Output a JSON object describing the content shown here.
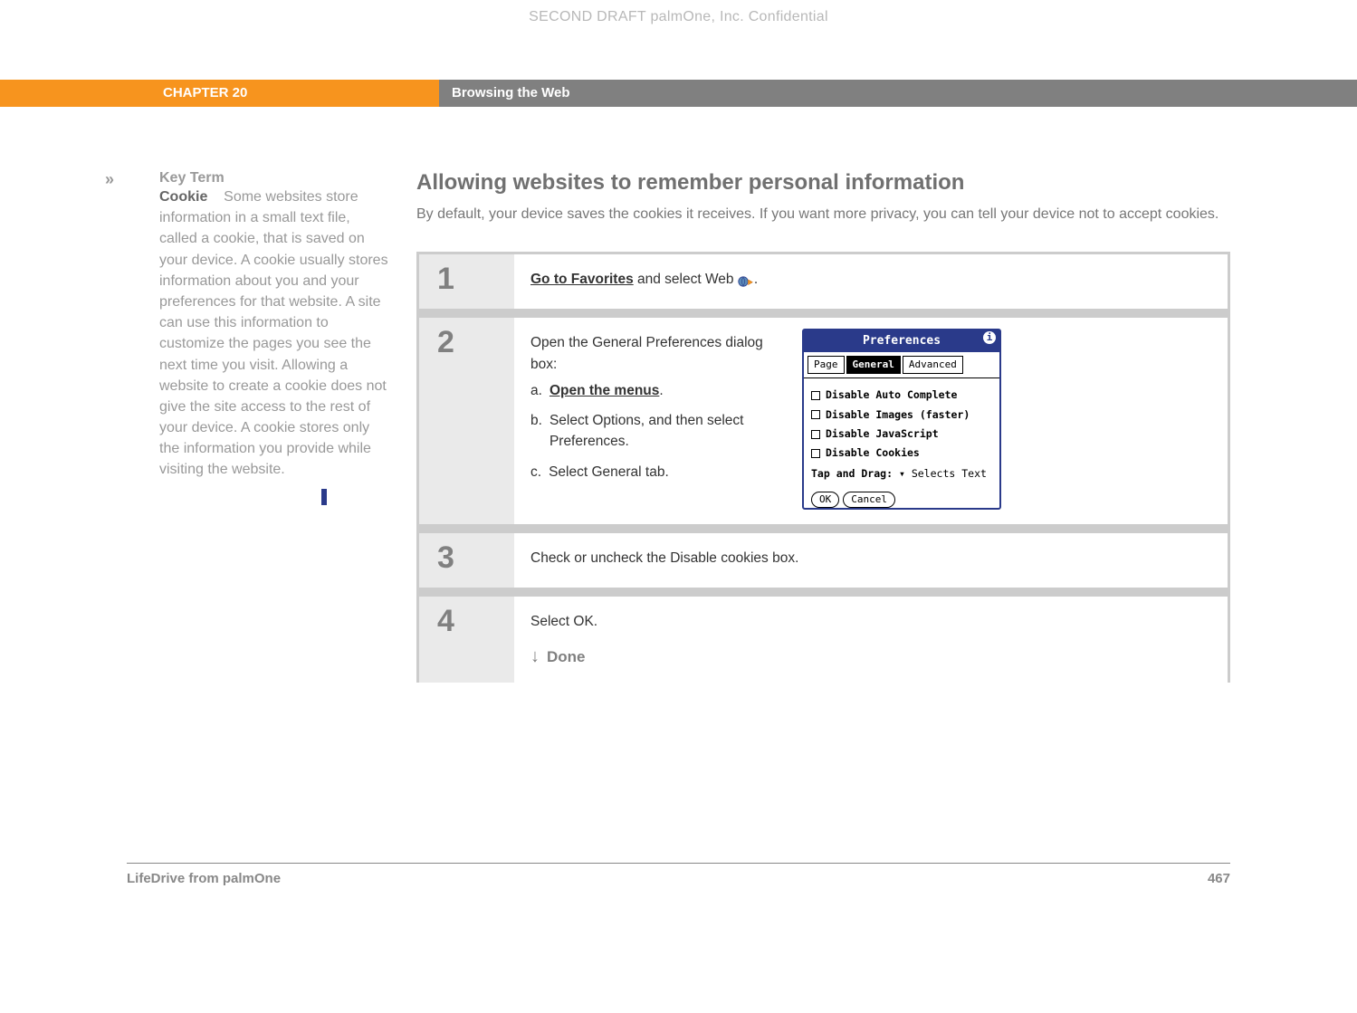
{
  "watermark": "SECOND DRAFT palmOne, Inc.  Confidential",
  "header": {
    "chapter": "CHAPTER 20",
    "title": "Browsing the Web"
  },
  "sidebar": {
    "marker": "»",
    "key_term_label": "Key Term",
    "term": "Cookie",
    "body": "Some websites store information in a small text file, called a cookie, that is saved on your device. A cookie usually stores information about you and your preferences for that website. A site can use this information to customize the pages you see the next time you visit. Allowing a website to create a cookie does not give the site access to the rest of your device. A cookie stores only the information you provide while visiting the website."
  },
  "main": {
    "heading": "Allowing websites to remember personal information",
    "intro": "By default, your device saves the cookies it receives. If you want more privacy, you can tell your device not to accept cookies."
  },
  "steps": {
    "s1": {
      "num": "1",
      "link": "Go to Favorites",
      "rest": " and select Web ",
      "period": "."
    },
    "s2": {
      "num": "2",
      "intro": "Open the General Preferences dialog box:",
      "a_letter": "a.",
      "a_link": "Open the menus",
      "a_period": ".",
      "b_letter": "b.",
      "b_text": "Select Options, and then select Preferences.",
      "c_letter": "c.",
      "c_text": "Select General tab."
    },
    "s3": {
      "num": "3",
      "text": "Check or uncheck the Disable cookies box."
    },
    "s4": {
      "num": "4",
      "text": "Select OK.",
      "done": "Done"
    }
  },
  "prefs": {
    "title": "Preferences",
    "info": "i",
    "tabs": {
      "page": "Page",
      "general": "General",
      "advanced": "Advanced"
    },
    "checks": {
      "autocomplete": "Disable Auto Complete",
      "images": "Disable Images (faster)",
      "js": "Disable JavaScript",
      "cookies": "Disable Cookies"
    },
    "tapdrag_label": "Tap and Drag:",
    "tapdrag_value": "Selects Text",
    "ok": "OK",
    "cancel": "Cancel"
  },
  "footer": {
    "product": "LifeDrive from palmOne",
    "page": "467"
  }
}
